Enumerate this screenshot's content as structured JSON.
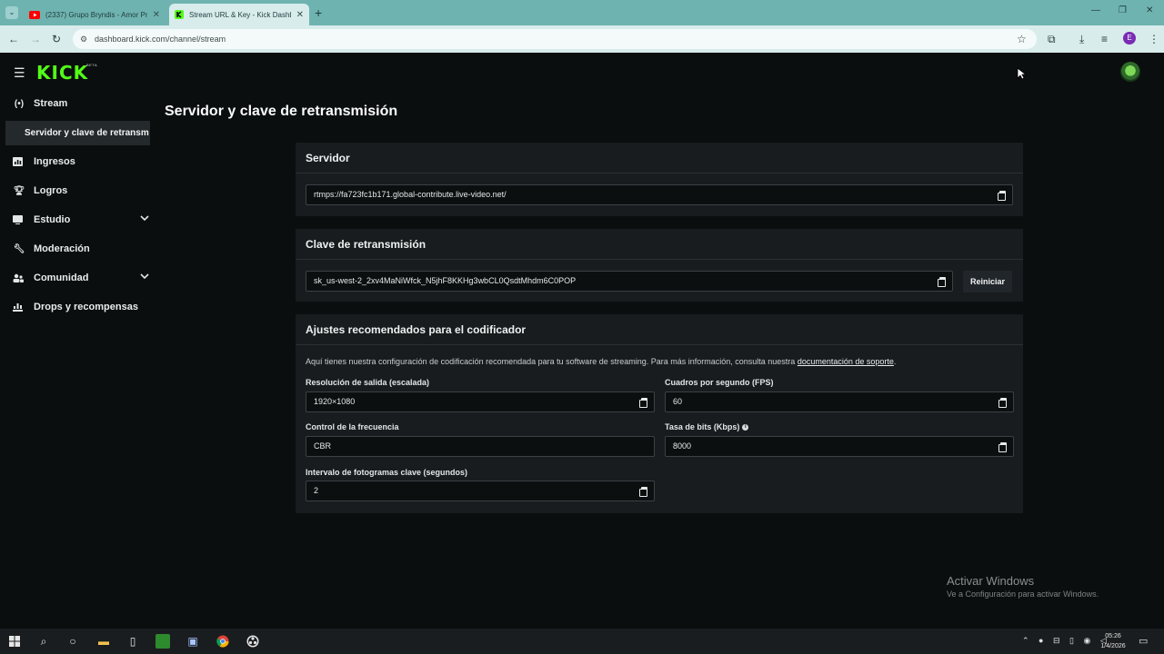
{
  "browser": {
    "tabs": [
      {
        "title": "(2337) Grupo Bryndis - Amor Pr",
        "icon": "youtube-icon",
        "icon_color": "#ff0000"
      },
      {
        "title": "Stream URL & Key - Kick Dashb",
        "icon": "kick-icon",
        "icon_color": "#53fc18",
        "active": true
      }
    ],
    "url": "dashboard.kick.com/channel/stream",
    "profile_initial": "E"
  },
  "app": {
    "logo": "KICK",
    "logo_badge": "BETA",
    "accent": "#53fc18",
    "sidebar": {
      "items": [
        {
          "label": "Stream",
          "icon": "broadcast-icon",
          "expandable": false
        },
        {
          "label": "Ingresos",
          "icon": "bar-chart-icon",
          "expandable": false
        },
        {
          "label": "Logros",
          "icon": "trophy-icon",
          "expandable": false
        },
        {
          "label": "Estudio",
          "icon": "studio-icon",
          "expandable": true
        },
        {
          "label": "Moderación",
          "icon": "wrench-icon",
          "expandable": false
        },
        {
          "label": "Comunidad",
          "icon": "community-icon",
          "expandable": true
        },
        {
          "label": "Drops y recompensas",
          "icon": "drops-icon",
          "expandable": false
        }
      ],
      "active_subitem": "Servidor y clave de retransm"
    },
    "page_title": "Servidor y clave de retransmisión",
    "server": {
      "heading": "Servidor",
      "value": "rtmps://fa723fc1b171.global-contribute.live-video.net/"
    },
    "key": {
      "heading": "Clave de retransmisión",
      "value": "sk_us-west-2_2xv4MaNiWfck_N5jhF8KKHg3wbCL0QsdtMhdm6C0POP",
      "reset_label": "Reiniciar"
    },
    "encoder": {
      "heading": "Ajustes recomendados para el codificador",
      "description": "Aquí tienes nuestra configuración de codificación recomendada para tu software de streaming. Para más información, consulta nuestra ",
      "link": "documentación de soporte",
      "period": ".",
      "fields": {
        "resolution": {
          "label": "Resolución de salida (escalada)",
          "value": "1920×1080"
        },
        "fps": {
          "label": "Cuadros por segundo (FPS)",
          "value": "60"
        },
        "rate_control": {
          "label": "Control de la frecuencia",
          "value": "CBR"
        },
        "bitrate": {
          "label": "Tasa de bits (Kbps)",
          "value": "8000"
        },
        "keyframe": {
          "label": "Intervalo de fotogramas clave (segundos)",
          "value": "2"
        }
      }
    }
  },
  "watermark": {
    "title": "Activar Windows",
    "subtitle": "Ve a Configuración para activar Windows."
  },
  "taskbar": {
    "time": "05:26",
    "date": "1/4/2026"
  }
}
